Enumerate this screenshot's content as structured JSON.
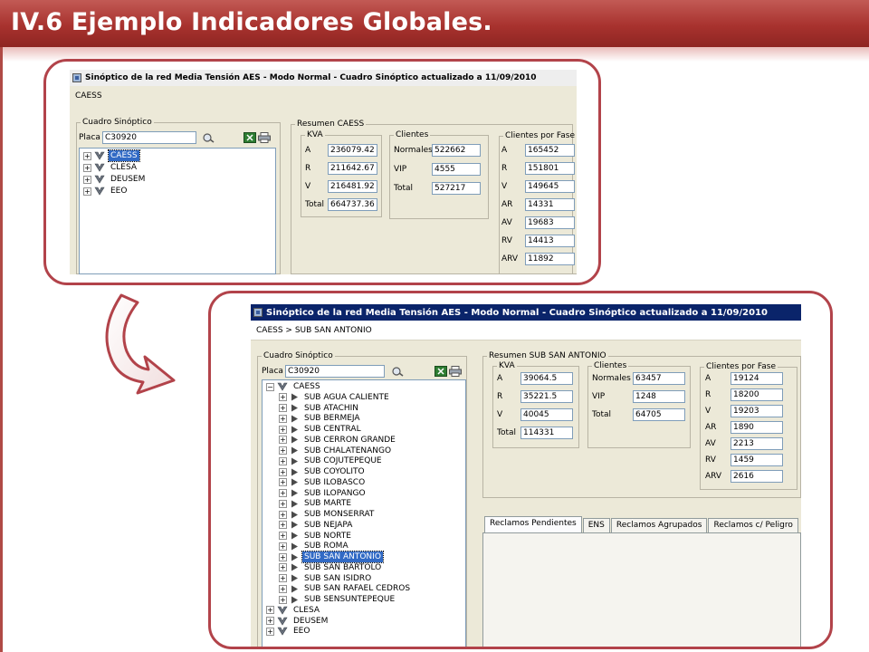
{
  "slide": {
    "title": "IV.6 Ejemplo Indicadores Globales."
  },
  "colors": {
    "accent": "#b2434a",
    "header": "#a8322e",
    "selection": "#316ac5"
  },
  "window1": {
    "title": "Sinóptico de la red Media Tensión AES -  Modo Normal - Cuadro Sinóptico actualizado a 11/09/2010",
    "breadcrumb": "CAESS",
    "cuadro": {
      "legend": "Cuadro Sinóptico",
      "placa_label": "Placa",
      "placa_value": "C30920",
      "tree": [
        {
          "label": "CAESS",
          "selected": true
        },
        {
          "label": "CLESA",
          "selected": false
        },
        {
          "label": "DEUSEM",
          "selected": false
        },
        {
          "label": "EEO",
          "selected": false
        }
      ]
    },
    "resumen": {
      "legend": "Resumen CAESS",
      "kva": {
        "legend": "KVA",
        "rows": [
          {
            "label": "A",
            "value": "236079.42"
          },
          {
            "label": "R",
            "value": "211642.67"
          },
          {
            "label": "V",
            "value": "216481.92"
          },
          {
            "label": "Total",
            "value": "664737.36"
          }
        ]
      },
      "clientes": {
        "legend": "Clientes",
        "rows": [
          {
            "label": "Normales",
            "value": "522662"
          },
          {
            "label": "VIP",
            "value": "4555"
          },
          {
            "label": "Total",
            "value": "527217"
          }
        ]
      },
      "fase": {
        "legend": "Clientes por Fase",
        "rows": [
          {
            "label": "A",
            "value": "165452"
          },
          {
            "label": "R",
            "value": "151801"
          },
          {
            "label": "V",
            "value": "149645"
          },
          {
            "label": "AR",
            "value": "14331"
          },
          {
            "label": "AV",
            "value": "19683"
          },
          {
            "label": "RV",
            "value": "14413"
          },
          {
            "label": "ARV",
            "value": "11892"
          }
        ]
      }
    }
  },
  "window2": {
    "title": "Sinóptico de la red Media Tensión AES -  Modo Normal - Cuadro Sinóptico actualizado a 11/09/2010",
    "breadcrumb": "CAESS  >  SUB SAN ANTONIO",
    "cuadro": {
      "legend": "Cuadro Sinóptico",
      "placa_label": "Placa",
      "placa_value": "C30920",
      "root": "CAESS",
      "subs": [
        "SUB AGUA CALIENTE",
        "SUB ATACHIN",
        "SUB BERMEJA",
        "SUB CENTRAL",
        "SUB CERRON GRANDE",
        "SUB CHALATENANGO",
        "SUB COJUTEPEQUE",
        "SUB COYOLITO",
        "SUB ILOBASCO",
        "SUB ILOPANGO",
        "SUB MARTE",
        "SUB MONSERRAT",
        "SUB NEJAPA",
        "SUB NORTE",
        "SUB ROMA",
        "SUB SAN ANTONIO",
        "SUB SAN BARTOLO",
        "SUB SAN ISIDRO",
        "SUB SAN RAFAEL CEDROS",
        "SUB SENSUNTEPEQUE"
      ],
      "selected_sub": "SUB SAN ANTONIO",
      "others": [
        "CLESA",
        "DEUSEM",
        "EEO"
      ]
    },
    "resumen": {
      "legend": "Resumen SUB SAN ANTONIO",
      "kva": {
        "legend": "KVA",
        "rows": [
          {
            "label": "A",
            "value": "39064.5"
          },
          {
            "label": "R",
            "value": "35221.5"
          },
          {
            "label": "V",
            "value": "40045"
          },
          {
            "label": "Total",
            "value": "114331"
          }
        ]
      },
      "clientes": {
        "legend": "Clientes",
        "rows": [
          {
            "label": "Normales",
            "value": "63457"
          },
          {
            "label": "VIP",
            "value": "1248"
          },
          {
            "label": "Total",
            "value": "64705"
          }
        ]
      },
      "fase": {
        "legend": "Clientes por Fase",
        "rows": [
          {
            "label": "A",
            "value": "19124"
          },
          {
            "label": "R",
            "value": "18200"
          },
          {
            "label": "V",
            "value": "19203"
          },
          {
            "label": "AR",
            "value": "1890"
          },
          {
            "label": "AV",
            "value": "2213"
          },
          {
            "label": "RV",
            "value": "1459"
          },
          {
            "label": "ARV",
            "value": "2616"
          }
        ]
      }
    },
    "tabs": [
      "Reclamos Pendientes",
      "ENS",
      "Reclamos Agrupados",
      "Reclamos c/ Peligro"
    ],
    "active_tab": 0
  }
}
